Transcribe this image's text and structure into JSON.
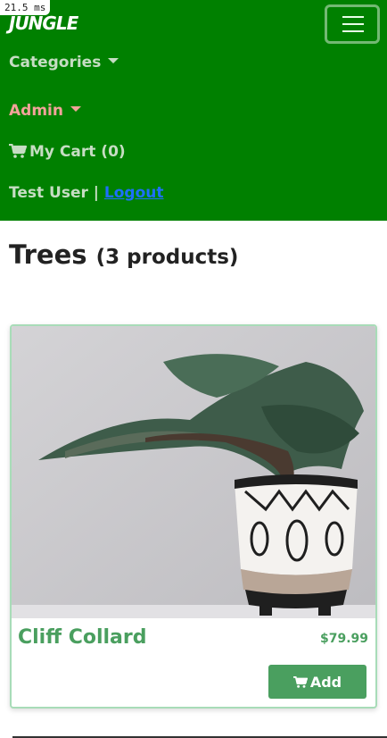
{
  "debug": {
    "timing": "21.5 ms"
  },
  "navbar": {
    "brand": "JUNGLE",
    "toggler_icon": "hamburger-icon",
    "categories_label": "Categories",
    "admin_label": "Admin",
    "cart_label": "My Cart (0)",
    "cart_icon": "shopping-cart-icon",
    "user_name": "Test User",
    "separator": " | ",
    "logout_label": "Logout",
    "colors": {
      "background": "#008000",
      "link": "#c6ddc3",
      "admin": "#f3a39a",
      "logout": "#1e6fff"
    }
  },
  "page": {
    "title": "Trees",
    "count": "(3 products)"
  },
  "products": [
    {
      "name": "Cliff Collard",
      "price": "$79.99",
      "add_label": "Add",
      "image": "bonsai-tree-in-patterned-pot",
      "colors": {
        "accent": "#4a9f5f"
      }
    }
  ]
}
